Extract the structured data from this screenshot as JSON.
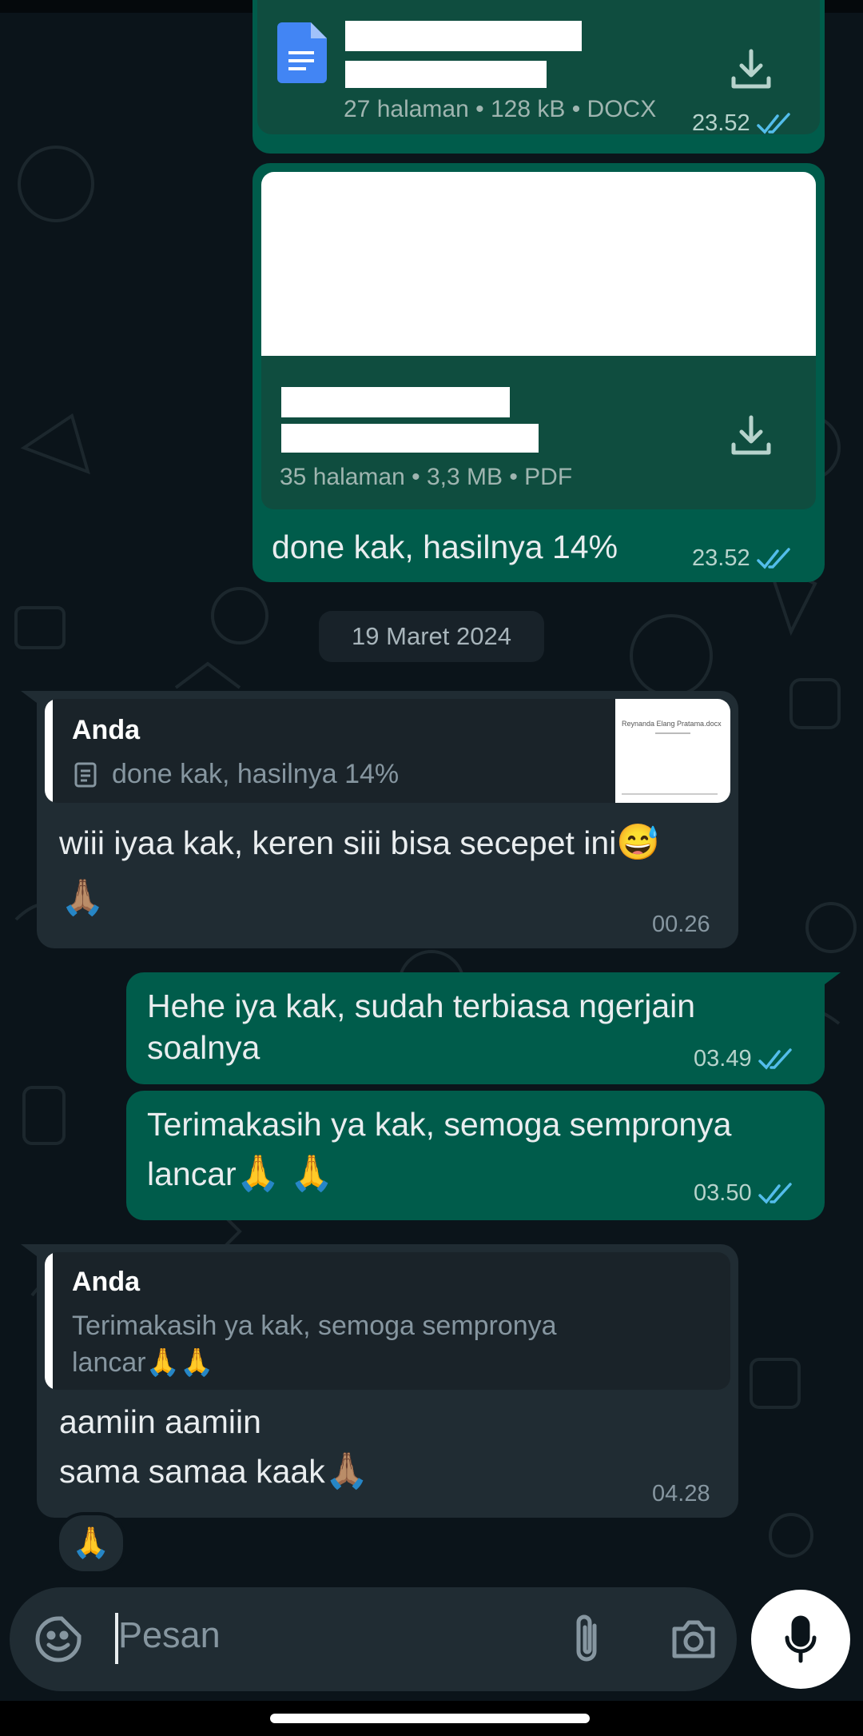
{
  "docx_message": {
    "file_meta": "27 halaman • 128 kB • DOCX",
    "time": "23.52"
  },
  "pdf_message": {
    "file_meta": "35 halaman • 3,3 MB • PDF",
    "caption": "done kak, hasilnya 14%",
    "time": "23.52"
  },
  "date_chip": "19 Maret 2024",
  "incoming_1": {
    "quote_author": "Anda",
    "quote_text": "done kak, hasilnya 14%",
    "thumb_caption": "Reynanda Elang Pratama.docx",
    "text_line1": "wiii iyaa kak, keren siii bisa secepet ini",
    "emoji_1": "😅",
    "emoji_2": "🙏🏽",
    "time": "00.26"
  },
  "outgoing_2": {
    "text_line1": "Hehe iya kak, sudah terbiasa ngerjain",
    "text_line2": "soalnya",
    "time": "03.49"
  },
  "outgoing_3": {
    "text_line1": "Terimakasih ya kak, semoga sempronya",
    "text_line2": "lancar",
    "emoji": "🙏 🙏",
    "time": "03.50"
  },
  "incoming_2": {
    "quote_author": "Anda",
    "quote_line1": "Terimakasih ya kak, semoga sempronya",
    "quote_line2": "lancar",
    "quote_emoji": "🙏🙏",
    "text_line1": "aamiin aamiin",
    "text_line2": "sama samaa kaak",
    "emoji": "🙏🏽",
    "time": "04.28",
    "reaction": "🙏"
  },
  "composer": {
    "placeholder": "Pesan"
  },
  "colors": {
    "background": "#0b141a",
    "outgoing_bubble": "#005c4b",
    "incoming_bubble": "#202c33",
    "read_ticks": "#53bdeb"
  },
  "icons": [
    "docs-file-icon",
    "download-icon",
    "read-receipt-icon",
    "document-icon",
    "sticker-icon",
    "attach-icon",
    "camera-icon",
    "mic-icon"
  ]
}
